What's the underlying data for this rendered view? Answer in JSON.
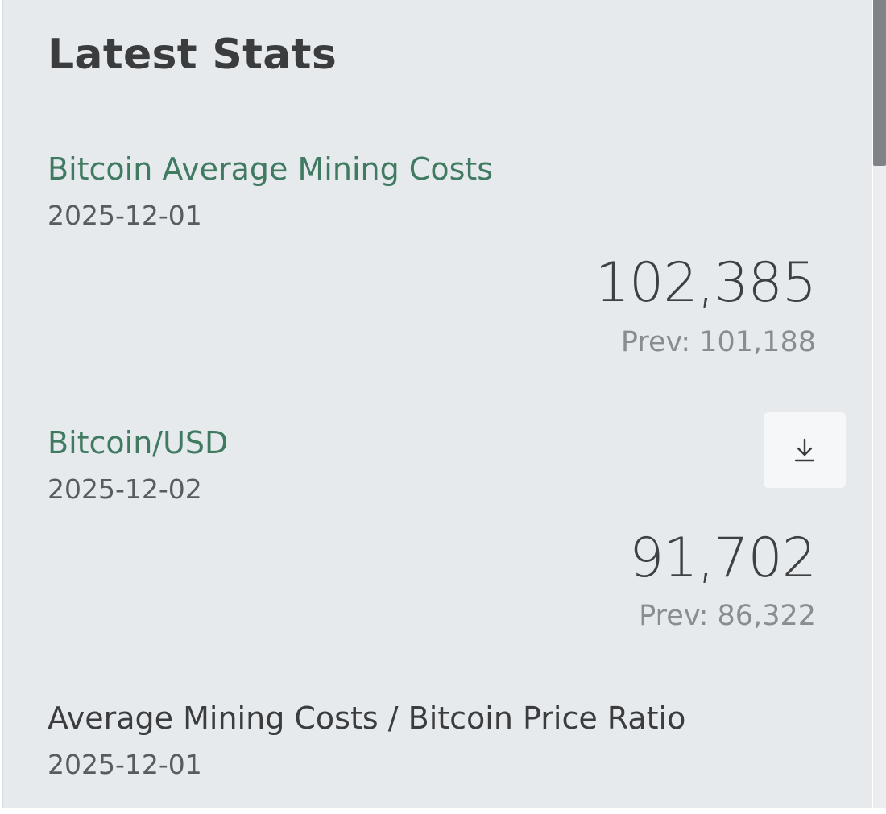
{
  "panel": {
    "title": "Latest Stats"
  },
  "stats": [
    {
      "name": "Bitcoin Average Mining Costs",
      "date": "2025-12-01",
      "value": "102,385",
      "prev": "Prev: 101,188"
    },
    {
      "name": "Bitcoin/USD",
      "date": "2025-12-02",
      "value": "91,702",
      "prev": "Prev: 86,322"
    },
    {
      "name": "Average Mining Costs / Bitcoin Price Ratio",
      "date": "2025-12-01"
    }
  ],
  "icons": {
    "download": "download-icon"
  },
  "colors": {
    "link_green": "#3f7a61",
    "card_bg": "#e6eaed",
    "value_text": "#3e4042",
    "prev_text": "#8a8d90"
  }
}
